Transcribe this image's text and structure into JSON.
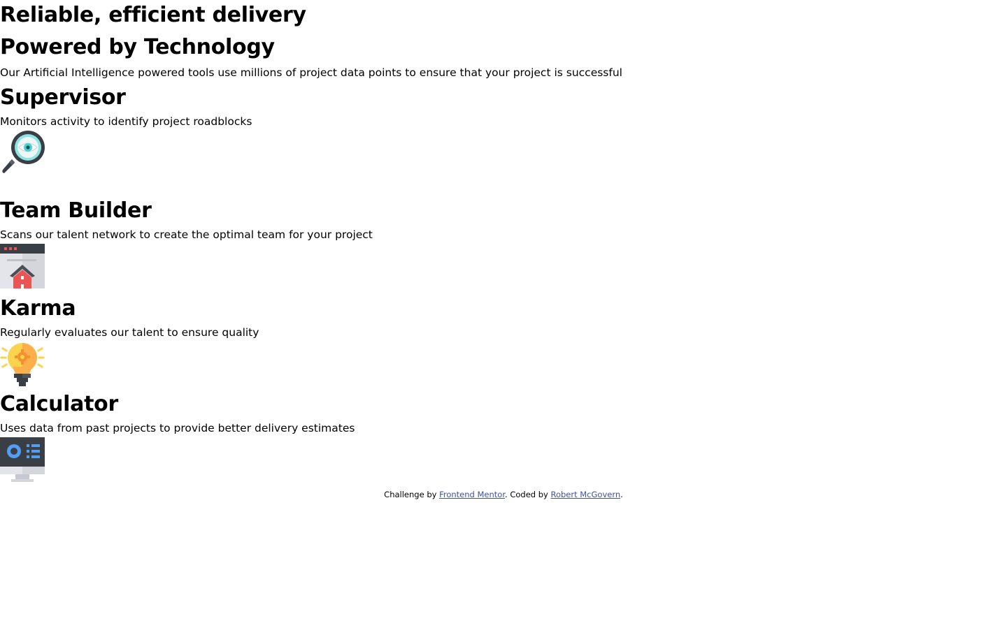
{
  "header": {
    "title_line1": "Reliable, efficient delivery",
    "title_line2": "Powered by Technology",
    "description": "Our Artificial Intelligence powered tools use millions of project data points to ensure that your project is successful"
  },
  "cards": [
    {
      "title": "Supervisor",
      "description": "Monitors activity to identify project roadblocks",
      "icon": "magnifier-eye-icon",
      "accent": "#44d3d2"
    },
    {
      "title": "Team Builder",
      "description": "Scans our talent network to create the optimal team for your project",
      "icon": "browser-home-icon",
      "accent": "#ea5454"
    },
    {
      "title": "Karma",
      "description": "Regularly evaluates our talent to ensure quality",
      "icon": "lightbulb-icon",
      "accent": "#fcaf4a"
    },
    {
      "title": "Calculator",
      "description": "Uses data from past projects to provide better delivery estimates",
      "icon": "monitor-dashboard-icon",
      "accent": "#549ef2"
    }
  ],
  "footer": {
    "prefix": "Challenge by ",
    "link1": "Frontend Mentor",
    "middle": ". Coded by ",
    "link2": "Robert McGovern",
    "suffix": ".",
    "link_color": "#3e52a3"
  }
}
